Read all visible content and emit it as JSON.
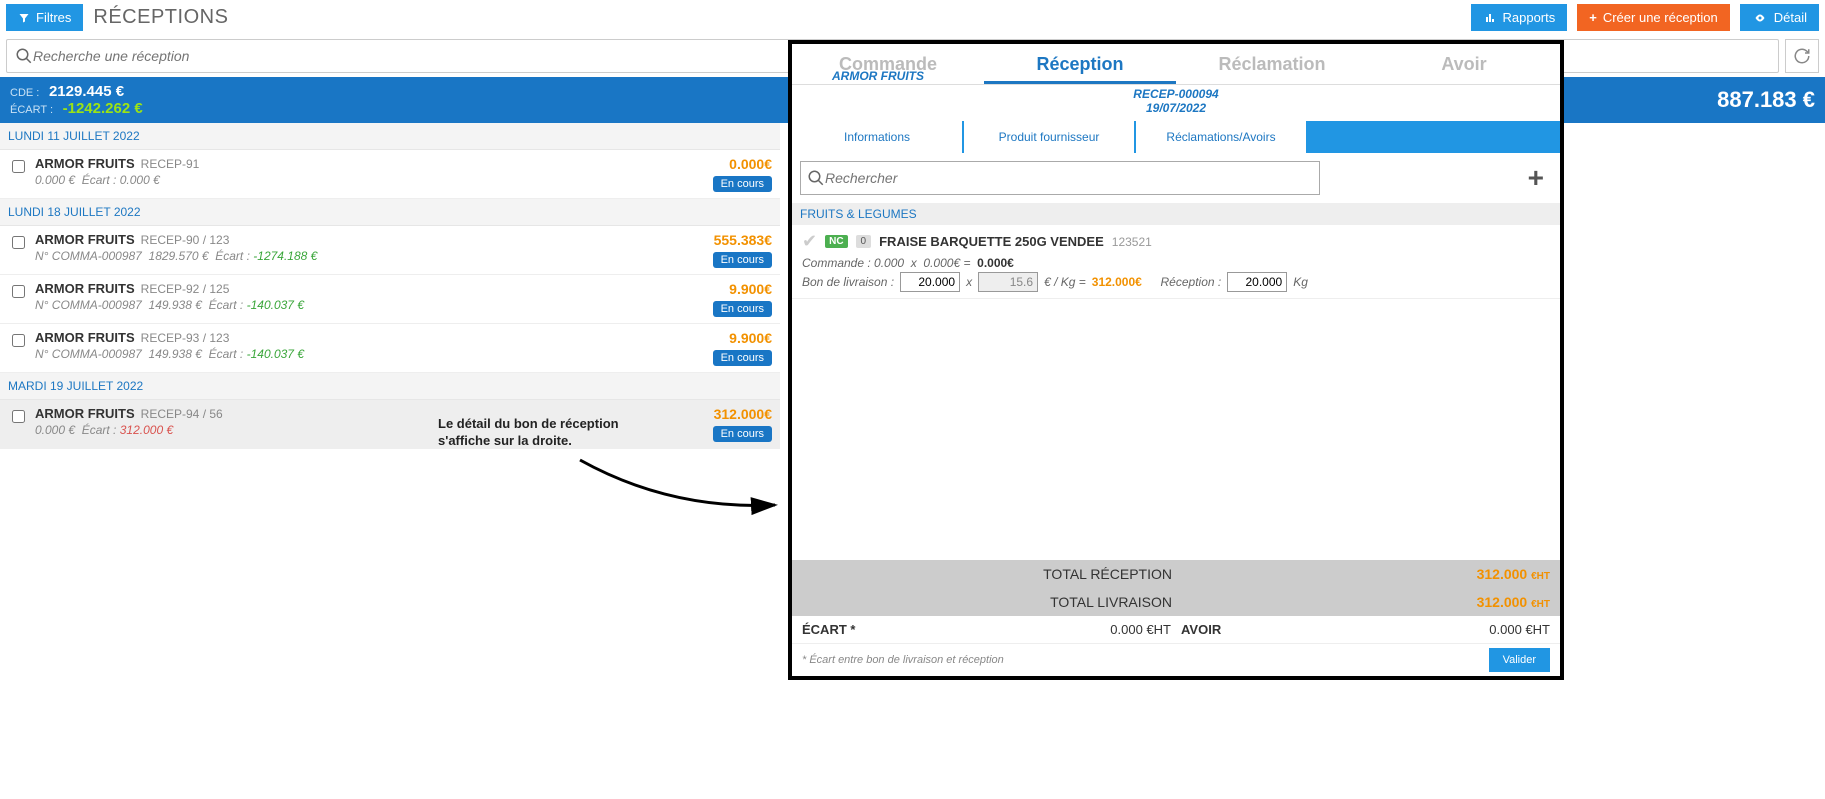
{
  "topbar": {
    "filters": "Filtres",
    "title": "RÉCEPTIONS",
    "reports": "Rapports",
    "create": "Créer une réception",
    "detail": "Détail"
  },
  "search": {
    "placeholder": "Recherche une réception"
  },
  "summary": {
    "cde_label": "CDE :",
    "cde_value": "2129.445 €",
    "ecart_label": "ÉCART :",
    "ecart_value": "-1242.262 €",
    "total": "887.183 €"
  },
  "list": [
    {
      "type": "date",
      "label": "LUNDI 11 JUILLET 2022"
    },
    {
      "type": "row",
      "supplier": "ARMOR FRUITS",
      "ref": "RECEP-91",
      "sub_left": "0.000 €",
      "ecart_label": "Écart :",
      "ecart_value": "0.000 €",
      "ecart_class": "",
      "amount": "0.000€",
      "status": "En cours"
    },
    {
      "type": "date",
      "label": "LUNDI 18 JUILLET 2022"
    },
    {
      "type": "row",
      "supplier": "ARMOR FRUITS",
      "ref": "RECEP-90 / 123",
      "comma": "N° COMMA-000987",
      "sub_left": "1829.570 €",
      "ecart_label": "Écart :",
      "ecart_value": "-1274.188 €",
      "ecart_class": "ecart-pos",
      "amount": "555.383€",
      "status": "En cours"
    },
    {
      "type": "row",
      "supplier": "ARMOR FRUITS",
      "ref": "RECEP-92 / 125",
      "comma": "N° COMMA-000987",
      "sub_left": "149.938 €",
      "ecart_label": "Écart :",
      "ecart_value": "-140.037 €",
      "ecart_class": "ecart-pos",
      "amount": "9.900€",
      "status": "En cours"
    },
    {
      "type": "row",
      "supplier": "ARMOR FRUITS",
      "ref": "RECEP-93 / 123",
      "comma": "N° COMMA-000987",
      "sub_left": "149.938 €",
      "ecart_label": "Écart :",
      "ecart_value": "-140.037 €",
      "ecart_class": "ecart-pos",
      "amount": "9.900€",
      "status": "En cours"
    },
    {
      "type": "date",
      "label": "MARDI 19 JUILLET 2022"
    },
    {
      "type": "row",
      "selected": true,
      "supplier": "ARMOR FRUITS",
      "ref": "RECEP-94 / 56",
      "sub_left": "0.000 €",
      "ecart_label": "Écart :",
      "ecart_value": "312.000 €",
      "ecart_class": "ecart-neg",
      "amount": "312.000€",
      "status": "En cours"
    }
  ],
  "annotation": "Le détail du bon de réception s'affiche sur la droite.",
  "detail": {
    "doc_tabs": [
      "Commande",
      "Réception",
      "Réclamation",
      "Avoir"
    ],
    "doc_tab_active": 1,
    "supplier_faded": "ARMOR FRUITS",
    "doc_ref": "RECEP-000094",
    "doc_date": "19/07/2022",
    "subtabs": [
      "Informations",
      "Produit fournisseur",
      "Réclamations/Avoirs"
    ],
    "search_placeholder": "Rechercher",
    "category": "FRUITS & LEGUMES",
    "product": {
      "nc": "NC",
      "count": "0",
      "name": "FRAISE BARQUETTE 250G VENDEE",
      "code": "123521",
      "cmd_label": "Commande :",
      "cmd_qty": "0.000",
      "cmd_x": "x",
      "cmd_unit": "0.000€",
      "cmd_eq": "=",
      "cmd_total": "0.000€",
      "bl_label": "Bon de livraison :",
      "bl_qty": "20.000",
      "bl_x": "x",
      "bl_price": "15.6",
      "bl_unit": "€ / Kg =",
      "bl_total": "312.000€",
      "recep_label": "Réception :",
      "recep_qty": "20.000",
      "recep_unit": "Kg"
    },
    "totals": {
      "reception_label": "TOTAL RÉCEPTION",
      "reception_value": "312.000",
      "livraison_label": "TOTAL LIVRAISON",
      "livraison_value": "312.000",
      "ht": "€HT",
      "ecart_label": "ÉCART *",
      "ecart_value": "0.000 €HT",
      "avoir_label": "AVOIR",
      "avoir_value": "0.000 €HT"
    },
    "footnote": "* Écart entre bon de livraison et réception",
    "validate": "Valider"
  }
}
